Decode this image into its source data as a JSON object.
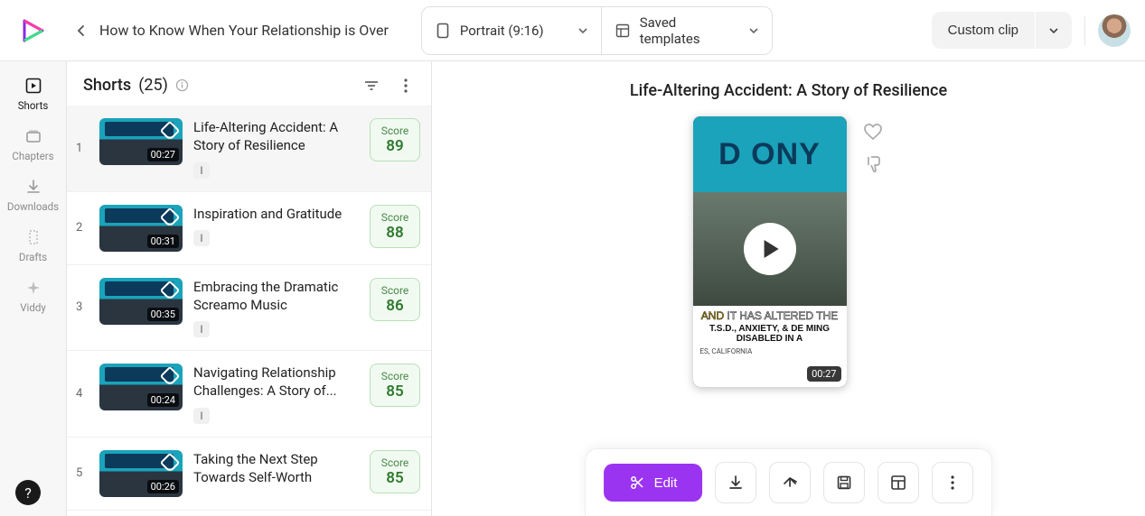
{
  "header": {
    "breadcrumb": "How to Know When Your Relationship is Over",
    "aspect_dropdown": "Portrait (9:16)",
    "template_dropdown": "Saved templates",
    "custom_clip": "Custom clip"
  },
  "rail": {
    "shorts": "Shorts",
    "chapters": "Chapters",
    "downloads": "Downloads",
    "drafts": "Drafts",
    "viddy": "Viddy",
    "help": "?"
  },
  "shorts_panel": {
    "title": "Shorts",
    "count": "(25)",
    "items": [
      {
        "index": "1",
        "duration": "00:27",
        "title": "Life-Altering Accident: A Story of Resilience",
        "score_label": "Score",
        "score": "89"
      },
      {
        "index": "2",
        "duration": "00:31",
        "title": "Inspiration and Gratitude",
        "score_label": "Score",
        "score": "88"
      },
      {
        "index": "3",
        "duration": "00:35",
        "title": "Embracing the Dramatic Screamo Music",
        "score_label": "Score",
        "score": "86"
      },
      {
        "index": "4",
        "duration": "00:24",
        "title": "Navigating Relationship Challenges: A Story of...",
        "score_label": "Score",
        "score": "85"
      },
      {
        "index": "5",
        "duration": "00:26",
        "title": "Taking the Next Step Towards Self-Worth",
        "score_label": "Score",
        "score": "85"
      }
    ]
  },
  "preview": {
    "title": "Life-Altering Accident: A Story of Resilience",
    "big_text": "D ONY",
    "cap1_yellow": "AND",
    "cap1_white": "IT HAS ALTERED THE",
    "cap2": "T.S.D., ANXIETY, & DE MING DISABLED IN A",
    "location": "ES, CALIFORNIA",
    "duration": "00:27"
  },
  "actions": {
    "edit": "Edit"
  }
}
